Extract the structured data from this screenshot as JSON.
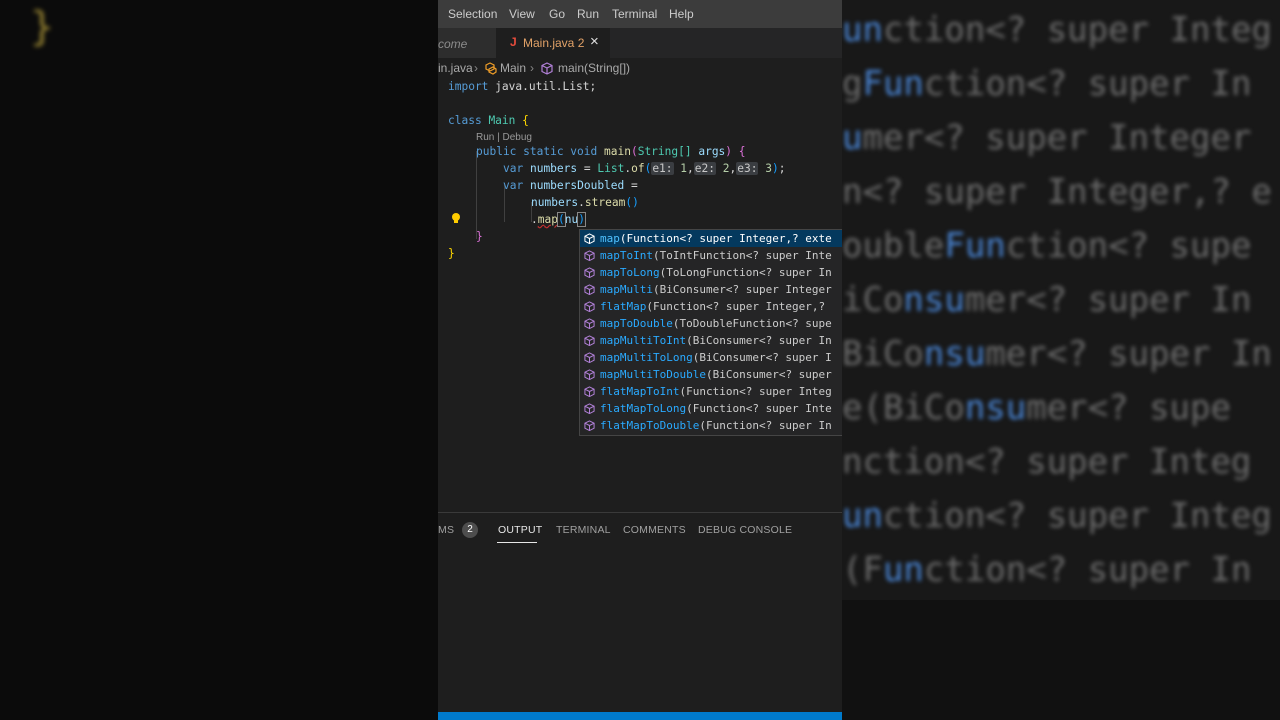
{
  "background": {
    "left_brace": "}",
    "right_lines": [
      {
        "pre": "",
        "hl": "un",
        "post": "ction<? super Integ"
      },
      {
        "pre": "g",
        "hl": "Fun",
        "post": "ction<? super In"
      },
      {
        "pre": "",
        "hl": "u",
        "post": "mer<? super Integer"
      },
      {
        "pre": "n<? super Integer,? e",
        "hl": "",
        "post": ""
      },
      {
        "pre": "ouble",
        "hl": "Fun",
        "post": "ction<? supe"
      },
      {
        "pre": "iCo",
        "hl": "nsu",
        "post": "mer<? super In"
      },
      {
        "pre": "BiCo",
        "hl": "nsu",
        "post": "mer<? super In"
      },
      {
        "pre": "e(BiCo",
        "hl": "nsu",
        "post": "mer<? supe"
      },
      {
        "pre": "",
        "hl": "",
        "post": "nction<? super Integ"
      },
      {
        "pre": "",
        "hl": "un",
        "post": "ction<? super Integ"
      },
      {
        "pre": "(F",
        "hl": "un",
        "post": "ction<? super In"
      }
    ]
  },
  "menu": [
    "Selection",
    "View",
    "Go",
    "Run",
    "Terminal",
    "Help"
  ],
  "tabs": {
    "welcome": "come",
    "main_icon": "J",
    "main_label": "Main.java 2",
    "close": "×"
  },
  "breadcrumb": {
    "file": "in.java",
    "sep": "›",
    "class_name": "Main",
    "method_name": "main(String[])"
  },
  "code": {
    "import_kw": "import",
    "import_path": "java.util.List;",
    "class_kw": "class",
    "class_name": "Main",
    "open_brace": "{",
    "codelens": "Run | Debug",
    "public_static_void": "public static void",
    "main_fn": "main",
    "string_type": "String[]",
    "args": "args",
    "var_kw": "var",
    "numbers": "numbers",
    "eq": "=",
    "list": "List",
    "of": "of",
    "hint_e1": "e1:",
    "val1": "1",
    "hint_e2": "e2:",
    "val2": "2",
    "hint_e3": "e3:",
    "val3": "3",
    "numbers_doubled": "numbersDoubled",
    "stream": "stream",
    "map_call": "map",
    "typed": "nu",
    "close_brace": "}"
  },
  "suggestions": [
    {
      "m": "map",
      "rest": "(Function<? super Integer,? exte",
      "selected": true
    },
    {
      "m": "mapToInt",
      "rest": "(ToIntFunction<? super Inte",
      "selected": false
    },
    {
      "m": "mapToLong",
      "rest": "(ToLongFunction<? super In",
      "selected": false
    },
    {
      "m": "mapMulti",
      "rest": "(BiConsumer<? super Integer",
      "selected": false
    },
    {
      "m": "flatMap",
      "rest": "(Function<? super Integer,? ",
      "selected": false
    },
    {
      "m": "mapToDouble",
      "rest": "(ToDoubleFunction<? supe",
      "selected": false
    },
    {
      "m": "mapMultiToInt",
      "rest": "(BiConsumer<? super In",
      "selected": false
    },
    {
      "m": "mapMultiToLong",
      "rest": "(BiConsumer<? super I",
      "selected": false
    },
    {
      "m": "mapMultiToDouble",
      "rest": "(BiConsumer<? super",
      "selected": false
    },
    {
      "m": "flatMapToInt",
      "rest": "(Function<? super Integ",
      "selected": false
    },
    {
      "m": "flatMapToLong",
      "rest": "(Function<? super Inte",
      "selected": false
    },
    {
      "m": "flatMapToDouble",
      "rest": "(Function<? super In",
      "selected": false
    }
  ],
  "panel": {
    "problems": "MS",
    "problems_count": "2",
    "output": "OUTPUT",
    "terminal": "TERMINAL",
    "comments": "COMMENTS",
    "debug_console": "DEBUG CONSOLE"
  },
  "colors": {
    "accent": "#007acc",
    "selection": "#04395e",
    "method_icon": "#b180d7"
  }
}
